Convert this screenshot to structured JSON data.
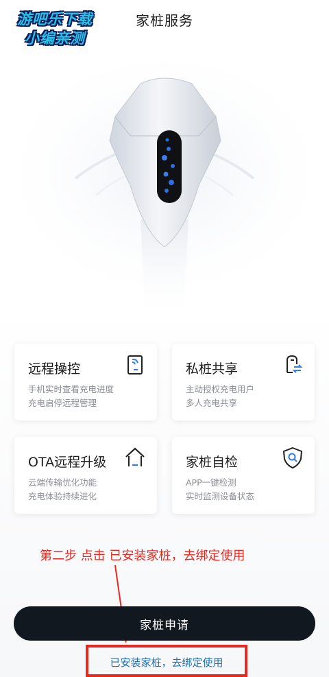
{
  "watermark": {
    "line1": "游吧乐下载",
    "line2": "小编亲测"
  },
  "header": {
    "title": "家桩服务"
  },
  "cards": [
    {
      "title": "远程操控",
      "desc1": "手机实时查看充电进度",
      "desc2": "充电启停远程管理",
      "icon": "remote-control-icon"
    },
    {
      "title": "私桩共享",
      "desc1": "主动授权充电用户",
      "desc2": "多人充电共享",
      "icon": "share-icon"
    },
    {
      "title": "OTA远程升级",
      "desc1": "云端传输优化功能",
      "desc2": "充电体验持续进化",
      "icon": "upgrade-icon"
    },
    {
      "title": "家桩自检",
      "desc1": "APP一键检测",
      "desc2": "实时监测设备状态",
      "icon": "shield-check-icon"
    }
  ],
  "annotation": {
    "text": "第二步 点击 已安装家桩，去绑定使用"
  },
  "buttons": {
    "apply": "家桩申请",
    "bind_link": "已安装家桩，去绑定使用"
  },
  "colors": {
    "primary_button": "#121820",
    "link": "#1f6fb5",
    "annotation": "#e8281f"
  }
}
